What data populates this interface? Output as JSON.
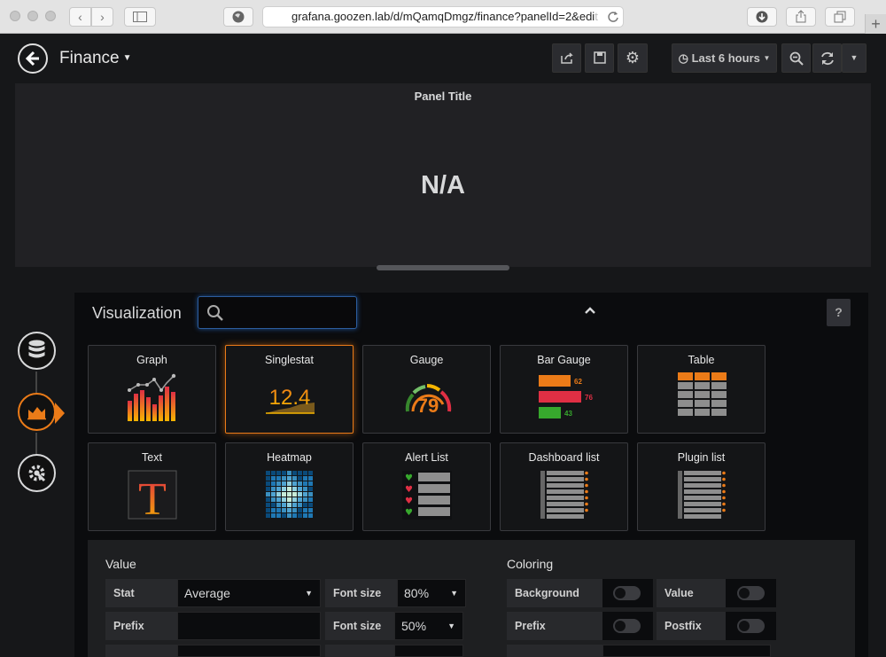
{
  "browser": {
    "url_main": "grafana.goozen.lab/d/mQamqDmgz/finance?panelId=2&edi",
    "url_faded": "t"
  },
  "dashboard": {
    "title": "Finance",
    "time_range": "Last 6 hours"
  },
  "panel": {
    "title": "Panel Title",
    "value": "N/A"
  },
  "visualization": {
    "heading": "Visualization",
    "search_placeholder": "",
    "help_label": "?",
    "cards": [
      {
        "name": "Graph",
        "icon": "graph-icon"
      },
      {
        "name": "Singlestat",
        "icon": "singlestat-icon",
        "selected": true
      },
      {
        "name": "Gauge",
        "icon": "gauge-icon"
      },
      {
        "name": "Bar Gauge",
        "icon": "bar-gauge-icon"
      },
      {
        "name": "Table",
        "icon": "table-icon"
      },
      {
        "name": "Text",
        "icon": "text-icon"
      },
      {
        "name": "Heatmap",
        "icon": "heatmap-icon"
      },
      {
        "name": "Alert List",
        "icon": "alert-list-icon"
      },
      {
        "name": "Dashboard list",
        "icon": "dashboard-list-icon"
      },
      {
        "name": "Plugin list",
        "icon": "plugin-list-icon"
      }
    ],
    "thumb_text": {
      "singlestat": "12.4",
      "gauge": "79",
      "bar_gauge": [
        "62",
        "76",
        "43"
      ],
      "text": "T"
    }
  },
  "options": {
    "value_section": "Value",
    "coloring_section": "Coloring",
    "stat_label": "Stat",
    "stat_value": "Average",
    "font_size_label_1": "Font size",
    "font_size_value_1": "80%",
    "prefix_label": "Prefix",
    "prefix_value": "",
    "font_size_label_2": "Font size",
    "font_size_value_2": "50%",
    "background_label": "Background",
    "value_label": "Value",
    "coloring_prefix_label": "Prefix",
    "postfix_label": "Postfix"
  },
  "colors": {
    "accent": "#eb7b18",
    "bg": "#161719",
    "panel_bg": "#212124",
    "focus_blue": "#2c5d9e"
  }
}
